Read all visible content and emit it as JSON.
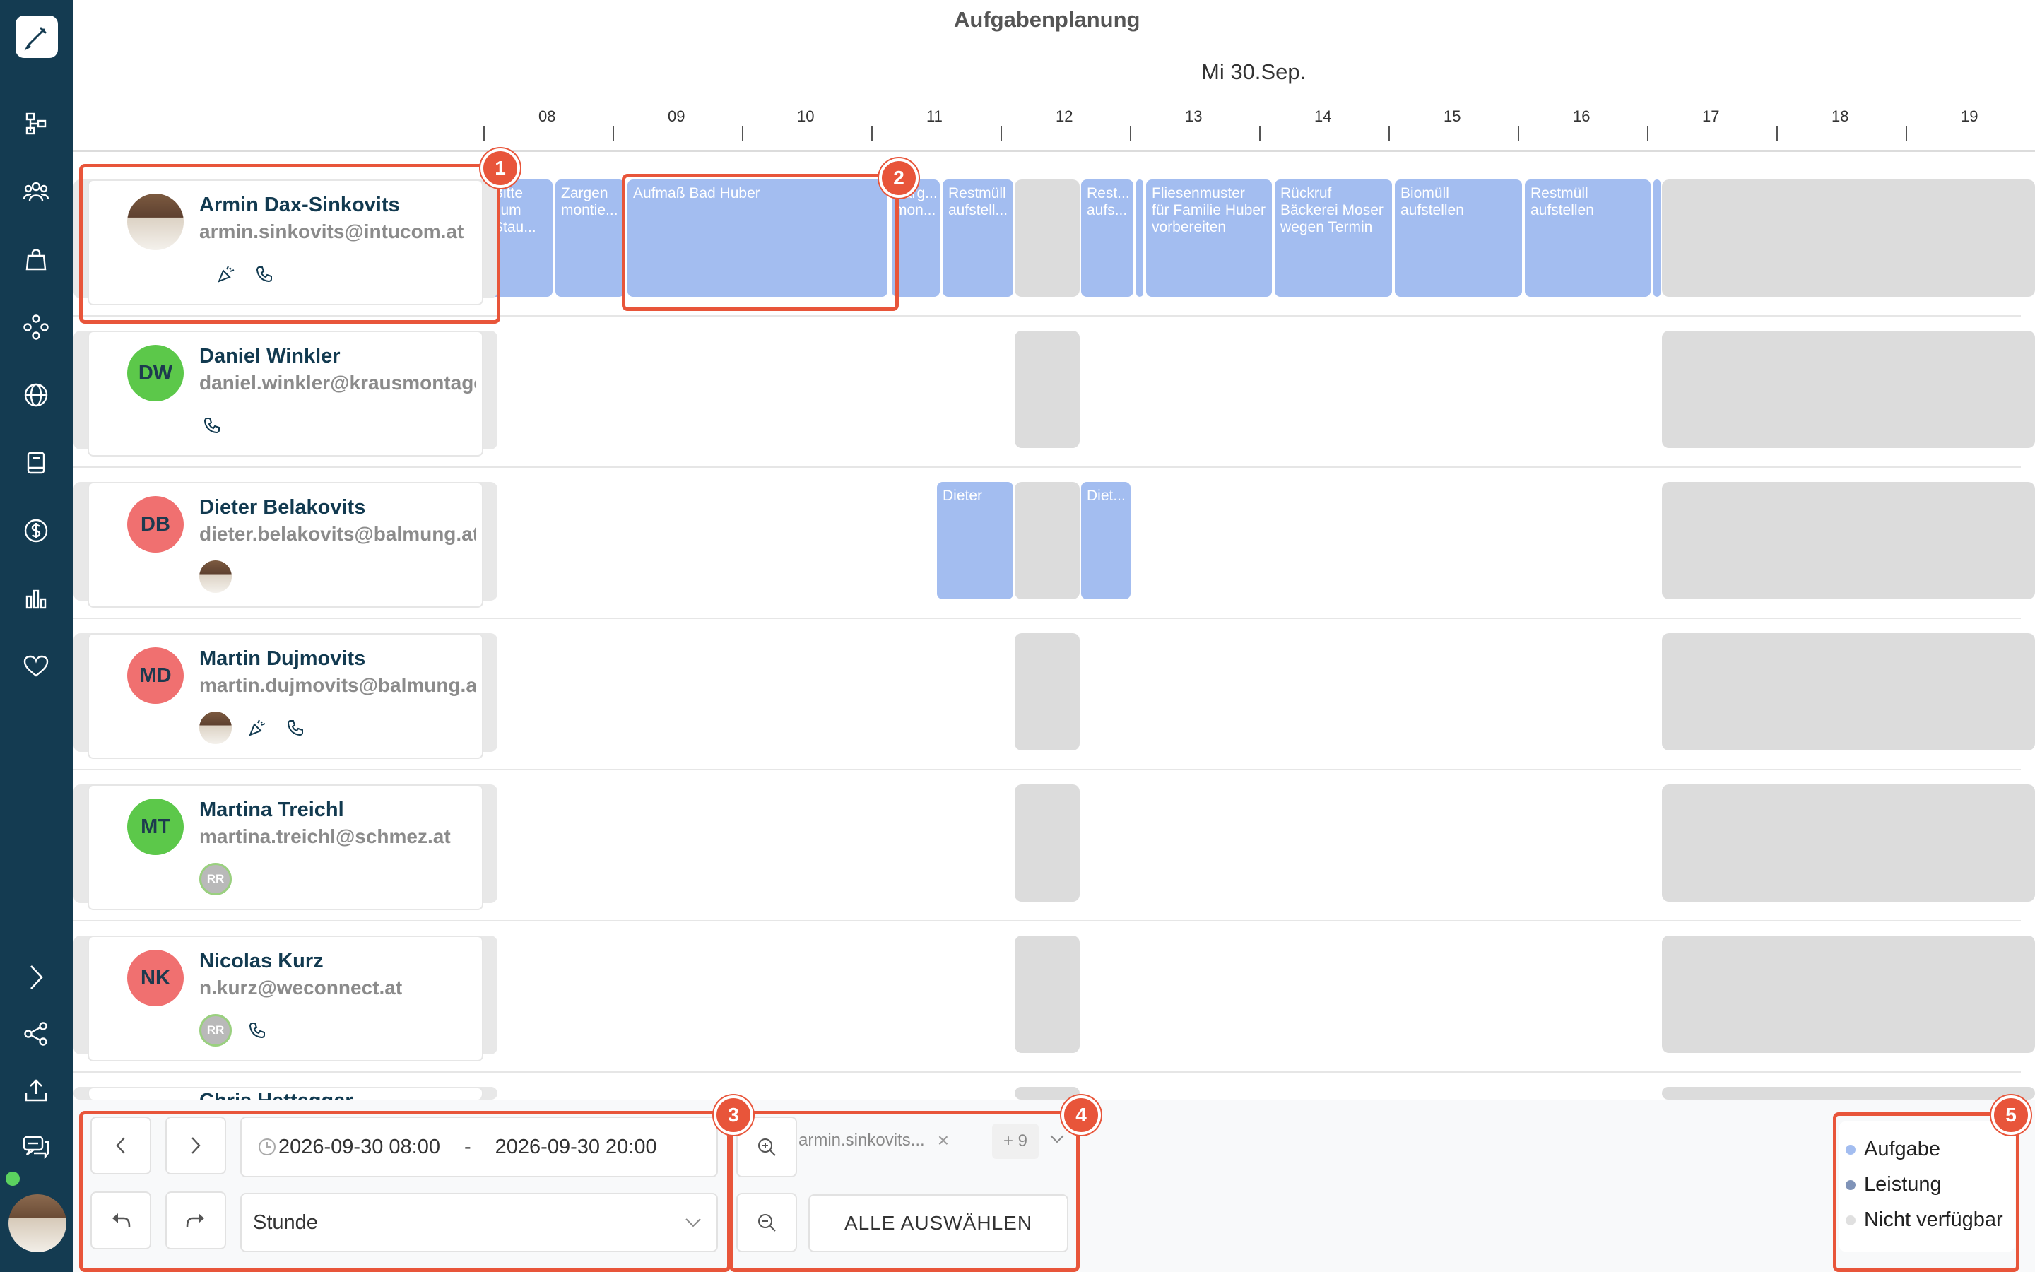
{
  "header": {
    "title": "Aufgabenplanung",
    "date": "Mi 30.Sep."
  },
  "timeline": {
    "hours": [
      "08",
      "09",
      "10",
      "11",
      "12",
      "13",
      "14",
      "15",
      "16",
      "17",
      "18",
      "19"
    ]
  },
  "sidebar": {
    "items": [
      "flowchart-icon",
      "users-icon",
      "bag-icon",
      "nodes-icon",
      "globe-icon",
      "book-icon",
      "dollar-icon",
      "bar-chart-icon",
      "heart-icon",
      "chevron-right-icon",
      "share-icon",
      "upload-icon",
      "chat-icon"
    ]
  },
  "employees": [
    {
      "name": "Armin Dax-Sinkovits",
      "email": "armin.sinkovits@intucom.at",
      "initials": "",
      "color": ""
    },
    {
      "name": "Daniel Winkler",
      "email": "daniel.winkler@krausmontage.at",
      "initials": "DW",
      "color": "#5cc84a"
    },
    {
      "name": "Dieter Belakovits",
      "email": "dieter.belakovits@balmung.at",
      "initials": "DB",
      "color": "#f07070"
    },
    {
      "name": "Martin Dujmovits",
      "email": "martin.dujmovits@balmung.at",
      "initials": "MD",
      "color": "#f07070"
    },
    {
      "name": "Martina Treichl",
      "email": "martina.treichl@schmez.at",
      "initials": "MT",
      "color": "#5cc84a"
    },
    {
      "name": "Nicolas Kurz",
      "email": "n.kurz@weconnect.at",
      "initials": "NK",
      "color": "#f07070"
    },
    {
      "name": "Chris Hettegger",
      "email": "",
      "initials": "",
      "color": "#f07070"
    }
  ],
  "badges": {
    "rr": "RR"
  },
  "tasks": {
    "armin": [
      "Bitte zum Stau...",
      "Zargen montie...",
      "Aufmaß Bad Huber",
      "Zarg... mon...",
      "Restmüll aufstell...",
      "Rest... aufs...",
      "Fliesenmuster für Familie Huber vorbereiten",
      "Rückruf Bäckerei Moser wegen Termin",
      "Biomüll aufstellen",
      "Restmüll aufstellen"
    ],
    "dieter": [
      "Dieter",
      "Diet..."
    ]
  },
  "controls": {
    "date_from": "2026-09-30 08:00",
    "separator": "-",
    "date_to": "2026-09-30 20:00",
    "interval": "Stunde",
    "filter_chip": "armin.sinkovits...",
    "filter_more": "+ 9",
    "select_all": "ALLE AUSWÄHLEN"
  },
  "legend": [
    {
      "label": "Aufgabe",
      "color": "#a3bdf0"
    },
    {
      "label": "Leistung",
      "color": "#7f93b8"
    },
    {
      "label": "Nicht verfügbar",
      "color": "#e0e0e0"
    }
  ],
  "callouts": [
    "1",
    "2",
    "3",
    "4",
    "5"
  ]
}
